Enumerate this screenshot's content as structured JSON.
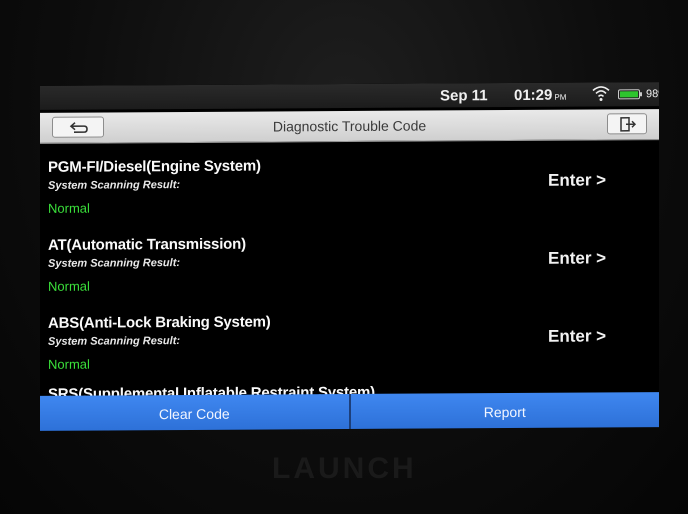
{
  "status_bar": {
    "date": "Sep 11",
    "time": "01:29",
    "ampm": "PM",
    "battery_percent": "98%",
    "battery_level": 0.98,
    "icons": [
      "wifi-icon",
      "battery-icon"
    ]
  },
  "title_bar": {
    "title": "Diagnostic Trouble Code",
    "back_icon": "back-icon",
    "exit_icon": "exit-icon"
  },
  "systems": [
    {
      "name": "PGM-FI/Diesel(Engine System)",
      "subtitle": "System Scanning Result:",
      "status": "Normal",
      "enter": "Enter >"
    },
    {
      "name": "AT(Automatic Transmission)",
      "subtitle": "System Scanning Result:",
      "status": "Normal",
      "enter": "Enter >"
    },
    {
      "name": "ABS(Anti-Lock Braking System)",
      "subtitle": "System Scanning Result:",
      "status": "Normal",
      "enter": "Enter >"
    },
    {
      "name": "SRS(Supplemental Inflatable Restraint System)"
    }
  ],
  "buttons": {
    "clear_code": "Clear Code",
    "report": "Report"
  },
  "brand": "LAUNCH",
  "colors": {
    "status_normal": "#3adf3a",
    "button_blue": "#3f87f0",
    "battery_green": "#2ec52e"
  }
}
